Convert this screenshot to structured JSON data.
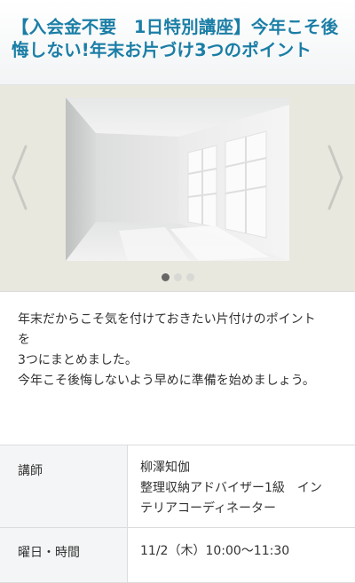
{
  "header": {
    "title_line1": "【入会金不要　1日特別講座】今年こそ後",
    "title_line2": "悔しない!年末お片づけ3つのポイント"
  },
  "carousel": {
    "prev_icon": "chevron-left-icon",
    "next_icon": "chevron-right-icon",
    "image": "empty-white-room-with-windows",
    "slide_count": 3,
    "active_index": 0
  },
  "description": {
    "line1": "年末だからこそ気を付けておきたい片付けのポイント",
    "line2": "を",
    "line3": "3つにまとめました。",
    "line4": "今年こそ後悔しないよう早めに準備を始めましょう。"
  },
  "details": {
    "instructor_label": "講師",
    "instructor_name": "柳澤知伽",
    "instructor_title_line1": "整理収納アドバイザー1級　イン",
    "instructor_title_line2": "テリアコーディネーター",
    "datetime_label": "曜日・時間",
    "datetime_value": "11/2（木）10:00～11:30"
  },
  "colors": {
    "title": "#1b7ea6",
    "carousel_bg": "#e9e8de",
    "dot_active": "#666666",
    "dot_inactive": "#d8d8d4"
  }
}
